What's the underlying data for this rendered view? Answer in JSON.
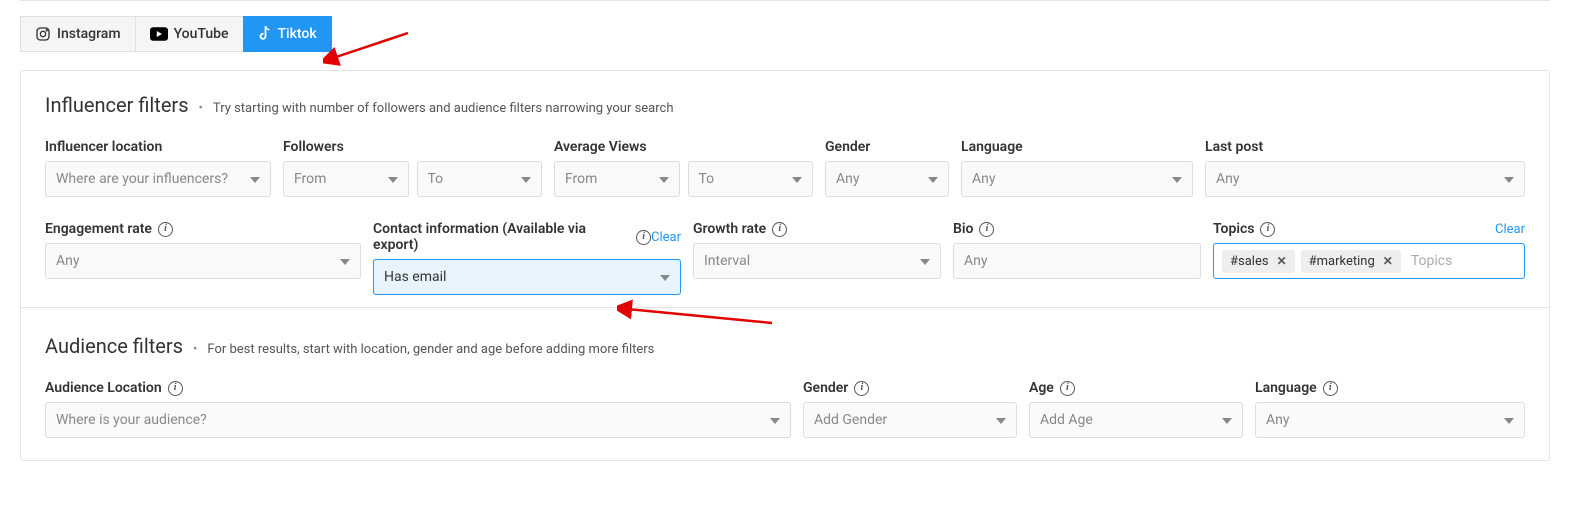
{
  "tabs": {
    "instagram": "Instagram",
    "youtube": "YouTube",
    "tiktok": "Tiktok",
    "active": "tiktok"
  },
  "influencer": {
    "title": "Influencer filters",
    "subtitle": "Try starting with number of followers and audience filters narrowing your search",
    "location_label": "Influencer location",
    "location_placeholder": "Where are your influencers?",
    "followers_label": "Followers",
    "followers_from": "From",
    "followers_to": "To",
    "avg_views_label": "Average Views",
    "avg_views_from": "From",
    "avg_views_to": "To",
    "gender_label": "Gender",
    "gender_placeholder": "Any",
    "language_label": "Language",
    "language_placeholder": "Any",
    "last_post_label": "Last post",
    "last_post_placeholder": "Any",
    "engagement_label": "Engagement rate",
    "engagement_placeholder": "Any",
    "contact_label": "Contact information (Available via export)",
    "contact_clear": "Clear",
    "contact_value": "Has email",
    "growth_label": "Growth rate",
    "growth_placeholder": "Interval",
    "bio_label": "Bio",
    "bio_placeholder": "Any",
    "topics_label": "Topics",
    "topics_clear": "Clear",
    "topics_chips": {
      "0": "#sales",
      "1": "#marketing"
    },
    "topics_placeholder": "Topics"
  },
  "audience": {
    "title": "Audience filters",
    "subtitle": "For best results, start with location, gender and age before adding more filters",
    "location_label": "Audience Location",
    "location_placeholder": "Where is your audience?",
    "gender_label": "Gender",
    "gender_placeholder": "Add Gender",
    "age_label": "Age",
    "age_placeholder": "Add Age",
    "language_label": "Language",
    "language_placeholder": "Any"
  }
}
